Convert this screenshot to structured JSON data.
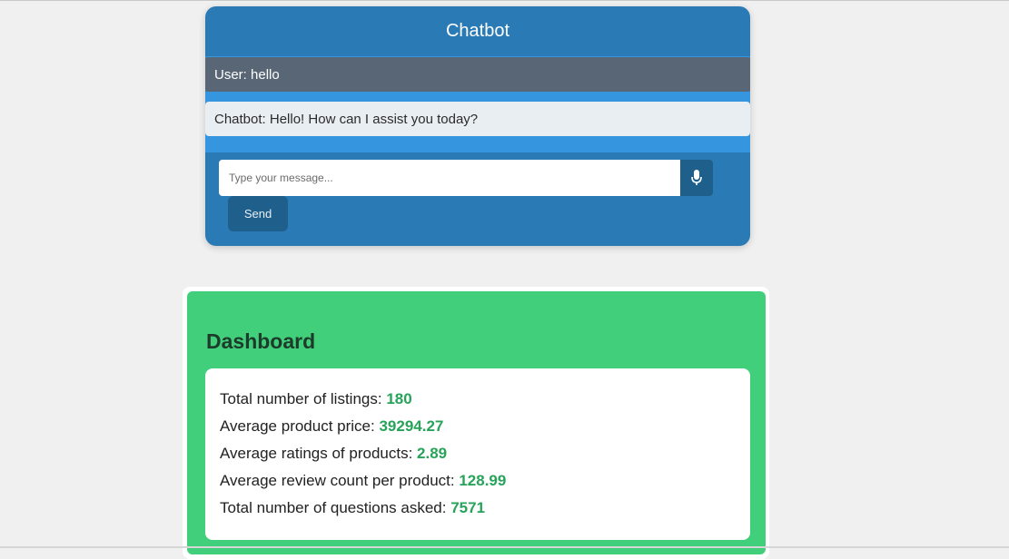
{
  "chatbot": {
    "title": "Chatbot",
    "messages": [
      {
        "role": "user",
        "text": "User: hello"
      },
      {
        "role": "bot",
        "text": "Chatbot: Hello! How can I assist you today?"
      }
    ],
    "input": {
      "placeholder": "Type your message...",
      "value": ""
    },
    "mic_icon": "microphone-icon",
    "send_label": "Send"
  },
  "dashboard": {
    "title": "Dashboard",
    "stats": [
      {
        "label": "Total number of listings: ",
        "value": "180"
      },
      {
        "label": "Average product price: ",
        "value": "39294.27"
      },
      {
        "label": "Average ratings of products: ",
        "value": "2.89"
      },
      {
        "label": "Average review count per product: ",
        "value": "128.99"
      },
      {
        "label": "Total number of questions asked: ",
        "value": "7571"
      }
    ]
  },
  "colors": {
    "chatbot_bg": "#2a7ab5",
    "chat_log_bg": "#3595df",
    "user_msg_bg": "#586675",
    "bot_msg_bg": "#e9eef2",
    "dashboard_bg": "#42cf7b",
    "stat_value": "#27a35a"
  }
}
